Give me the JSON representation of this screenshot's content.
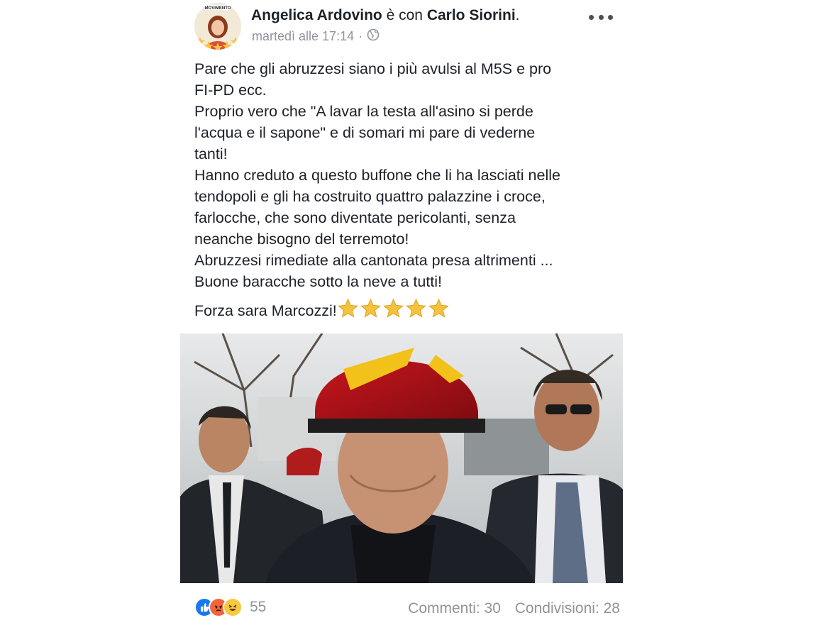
{
  "post": {
    "author": "Angelica Ardovino",
    "with_text": "è con",
    "tagged": "Carlo Siorini",
    "tagged_suffix": ".",
    "timestamp": "martedì alle 17:14",
    "separator": "·",
    "privacy_icon": "globe-icon",
    "avatar_badge": "MOVIMENTO",
    "body_lines": [
      "Pare che gli abruzzesi siano i più avulsi al M5S e pro",
      "FI-PD ecc.",
      "Proprio vero che \"A lavar la testa all'asino si perde",
      "l'acqua e il sapone\" e di somari mi pare di vederne",
      "tanti!",
      "Hanno creduto a questo buffone che li ha lasciati nelle",
      "tendopoli e gli ha costruito quattro palazzine i croce,",
      "farlocche, che sono diventate pericolanti, senza",
      "neanche bisogno del terremoto!",
      "Abruzzesi rimediate alla cantonata presa altrimenti ...",
      "Buone baracche sotto la neve a tutti!"
    ],
    "closing_line": "Forza sara Marcozzi!",
    "closing_emoji": "star-emoji",
    "closing_emoji_count": 5
  },
  "footer": {
    "reactions": [
      "like-icon",
      "angry-icon",
      "haha-icon"
    ],
    "reaction_count": "55",
    "comments": "Commenti: 30",
    "shares": "Condivisioni: 28"
  },
  "colors": {
    "text": "#1d2129",
    "meta": "#8f949b",
    "like_blue": "#1877f2",
    "angry_orange": "#f0653a",
    "haha_yellow": "#f7c940",
    "star": "#f6c23e"
  }
}
